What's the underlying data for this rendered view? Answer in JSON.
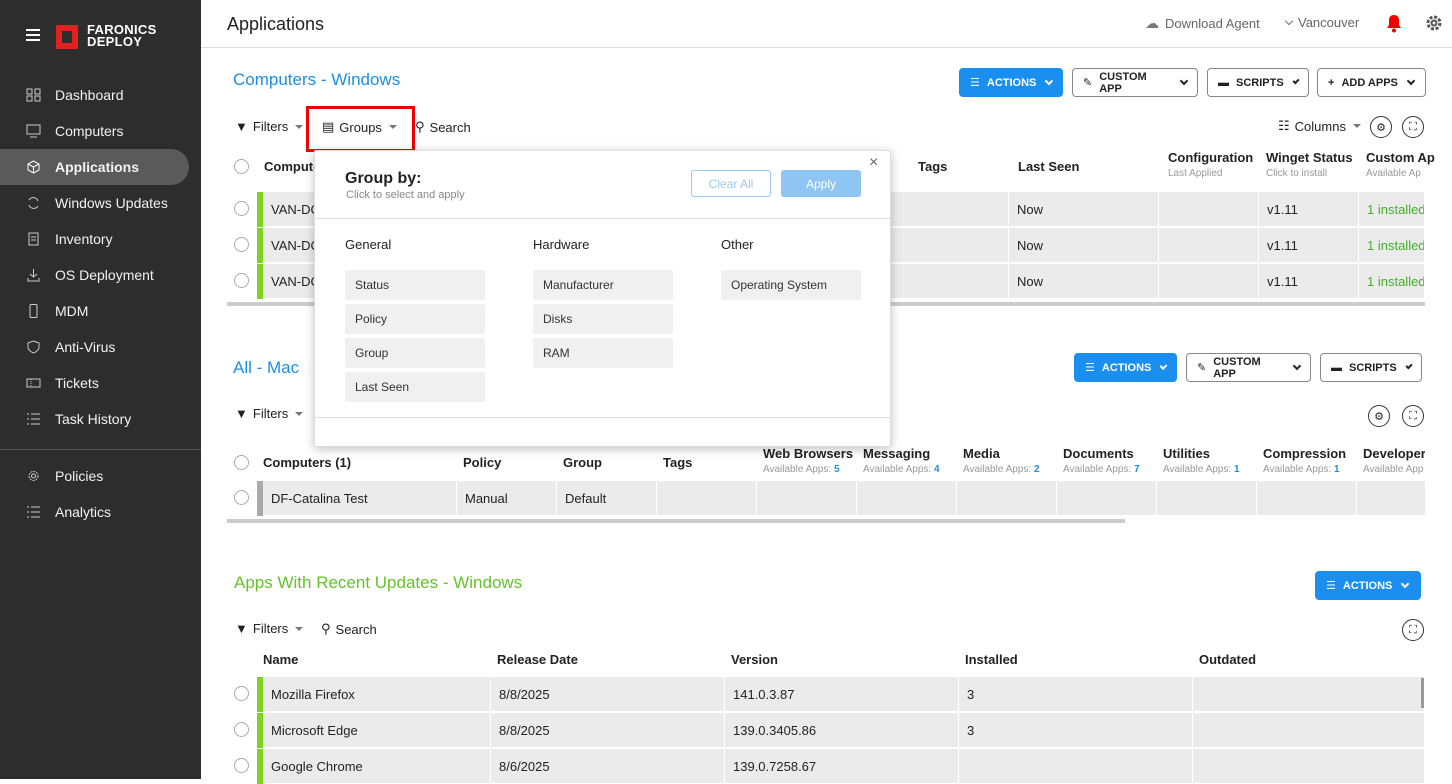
{
  "brand": {
    "line1": "FARONICS",
    "line2": "DEPLOY",
    "color": "#e0211d"
  },
  "nav": [
    {
      "label": "Dashboard",
      "icon": "dashboard-icon"
    },
    {
      "label": "Computers",
      "icon": "monitor-icon"
    },
    {
      "label": "Applications",
      "icon": "cube-icon",
      "active": true
    },
    {
      "label": "Windows Updates",
      "icon": "refresh-icon"
    },
    {
      "label": "Inventory",
      "icon": "clipboard-icon"
    },
    {
      "label": "OS Deployment",
      "icon": "download-icon"
    },
    {
      "label": "MDM",
      "icon": "phone-icon"
    },
    {
      "label": "Anti-Virus",
      "icon": "shield-icon"
    },
    {
      "label": "Tickets",
      "icon": "ticket-icon"
    },
    {
      "label": "Task History",
      "icon": "list-icon"
    }
  ],
  "nav2": [
    {
      "label": "Policies",
      "icon": "gear-icon"
    },
    {
      "label": "Analytics",
      "icon": "list-icon"
    }
  ],
  "header": {
    "title": "Applications",
    "download": "Download Agent",
    "site": "Vancouver"
  },
  "sec1": {
    "title": "Computers - Windows",
    "actions": "ACTIONS",
    "custom": "CUSTOM APP",
    "scripts": "SCRIPTS",
    "add": "ADD APPS",
    "filters": "Filters",
    "groups": "Groups",
    "search": "Search",
    "columns": "Columns",
    "headers": {
      "computer": "Compute",
      "tags": "Tags",
      "last_seen": "Last Seen",
      "config": "Configuration",
      "config_sub": "Last Applied",
      "winget": "Winget Status",
      "winget_sub": "Click to install",
      "custom": "Custom Ap",
      "custom_sub": "Available Ap"
    },
    "rows": [
      {
        "name": "VAN-DC",
        "seen": "Now",
        "winget": "v1.11",
        "custom": "1 installed"
      },
      {
        "name": "VAN-DC",
        "seen": "Now",
        "winget": "v1.11",
        "custom": "1 installed"
      },
      {
        "name": "VAN-DC",
        "seen": "Now",
        "winget": "v1.11",
        "custom": "1 installed"
      }
    ]
  },
  "sec2": {
    "title": "All - Mac",
    "actions": "ACTIONS",
    "custom": "CUSTOM APP",
    "scripts": "SCRIPTS",
    "filters": "Filters",
    "headers": {
      "computers": "Computers (1)",
      "policy": "Policy",
      "group": "Group",
      "tags": "Tags"
    },
    "cats": [
      {
        "name": "Web Browsers",
        "label": "Available Apps:",
        "n": "5"
      },
      {
        "name": "Messaging",
        "label": "Available Apps:",
        "n": "4"
      },
      {
        "name": "Media",
        "label": "Available Apps:",
        "n": "2"
      },
      {
        "name": "Documents",
        "label": "Available Apps:",
        "n": "7"
      },
      {
        "name": "Utilities",
        "label": "Available Apps:",
        "n": "1"
      },
      {
        "name": "Compression",
        "label": "Available Apps:",
        "n": "1"
      },
      {
        "name": "Developer",
        "label": "Available App",
        "n": ""
      }
    ],
    "row": {
      "name": "DF-Catalina Test",
      "policy": "Manual",
      "group": "Default"
    }
  },
  "sec3": {
    "title": "Apps With Recent Updates - Windows",
    "actions": "ACTIONS",
    "filters": "Filters",
    "search": "Search",
    "headers": {
      "name": "Name",
      "date": "Release Date",
      "version": "Version",
      "installed": "Installed",
      "outdated": "Outdated"
    },
    "rows": [
      {
        "name": "Mozilla Firefox",
        "date": "8/8/2025",
        "version": "141.0.3.87",
        "installed": "3"
      },
      {
        "name": "Microsoft Edge",
        "date": "8/8/2025",
        "version": "139.0.3405.86",
        "installed": "3"
      },
      {
        "name": "Google Chrome",
        "date": "8/6/2025",
        "version": "139.0.7258.67",
        "installed": ""
      }
    ]
  },
  "popup": {
    "title": "Group by:",
    "subtitle": "Click to select and apply",
    "clear": "Clear All",
    "apply": "Apply",
    "close": "×",
    "general": {
      "label": "General",
      "items": [
        "Status",
        "Policy",
        "Group",
        "Last Seen"
      ]
    },
    "hardware": {
      "label": "Hardware",
      "items": [
        "Manufacturer",
        "Disks",
        "RAM"
      ]
    },
    "other": {
      "label": "Other",
      "items": [
        "Operating System"
      ]
    }
  },
  "colors": {
    "accent": "#1a8ff0",
    "green": "#66c22b",
    "highlight": "#e00000"
  }
}
